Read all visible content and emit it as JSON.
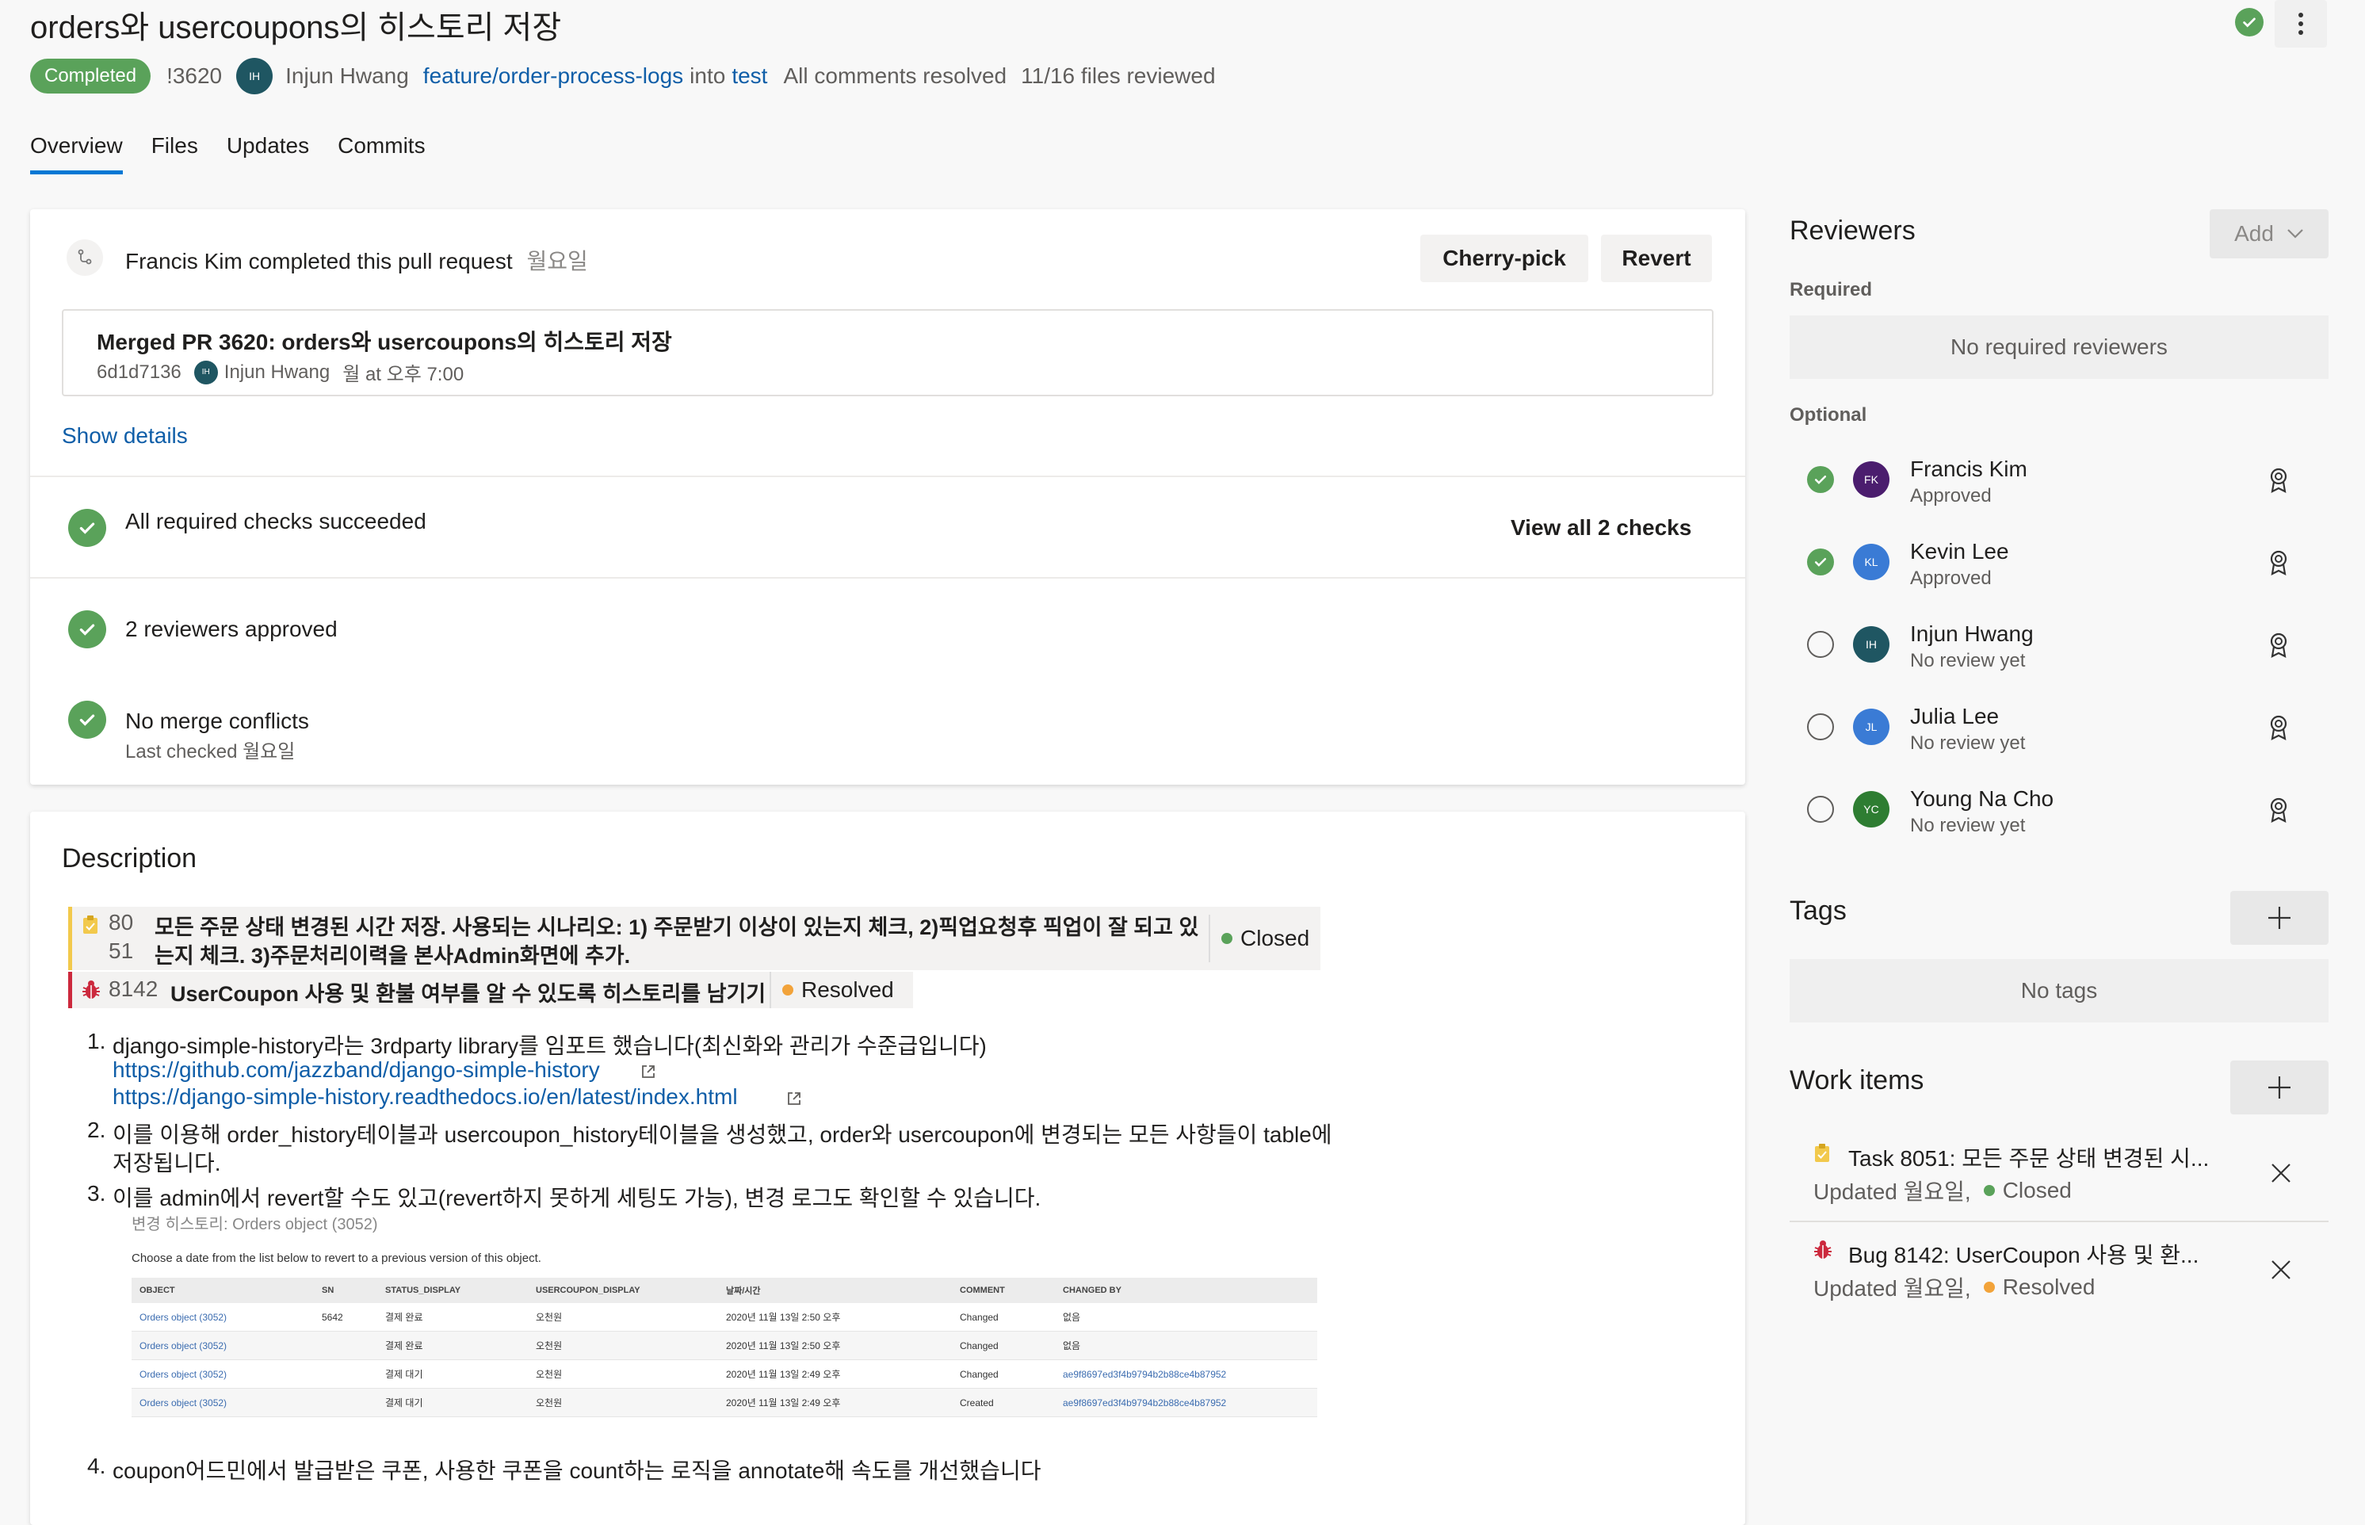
{
  "header": {
    "title": "orders와 usercoupons의 히스토리 저장",
    "status": "Completed",
    "pr_id": "!3620",
    "author_initials": "IH",
    "author": "Injun Hwang",
    "source_branch": "feature/order-process-logs",
    "into_label": "into",
    "target_branch": "test",
    "comments_status": "All comments resolved",
    "files_reviewed": "11/16 files reviewed"
  },
  "tabs": [
    "Overview",
    "Files",
    "Updates",
    "Commits"
  ],
  "completion": {
    "message": "Francis Kim completed this pull request",
    "when": "월요일",
    "cherry_pick": "Cherry-pick",
    "revert": "Revert",
    "merge_title": "Merged PR 3620: orders와 usercoupons의 히스토리 저장",
    "commit": "6d1d7136",
    "committer_initials": "IH",
    "committer": "Injun Hwang",
    "commit_time": "월 at 오후 7:00",
    "show_details": "Show details"
  },
  "checks": {
    "required_checks": "All required checks succeeded",
    "view_all": "View all 2 checks",
    "reviewers_approved": "2 reviewers approved",
    "merge_conflicts": "No merge conflicts",
    "last_checked": "Last checked 월요일"
  },
  "description": {
    "heading": "Description",
    "work_items": [
      {
        "num_a": "80",
        "num_b": "51",
        "text": "모든 주문 상태 변경된 시간 저장. 사용되는 시나리오: 1) 주문받기 이상이 있는지 체크, 2)픽업요청후 픽업이 잘 되고 있",
        "text2": "는지 체크. 3)주문처리이력을 본사Admin화면에 추가.",
        "state": "Closed",
        "state_color": "#5aa25a"
      },
      {
        "num_a": "8142",
        "text": "UserCoupon 사용 및 환불 여부를 알 수 있도록 히스토리를 남기기",
        "state": "Resolved",
        "state_color": "#f2a33a"
      }
    ],
    "items": [
      {
        "num": "1.",
        "text": "django-simple-history라는 3rdparty library를 임포트 했습니다(최신화와 관리가 수준급입니다)"
      },
      {
        "num": "2.",
        "text": "이를 이용해 order_history테이블과 usercoupon_history테이블을 생성했고, order와 usercoupon에 변경되는 모든 사항들이 table에",
        "text2": "저장됩니다."
      },
      {
        "num": "3.",
        "text": "이를 admin에서 revert할 수도 있고(revert하지 못하게 세팅도 가능), 변경 로그도 확인할 수 있습니다."
      },
      {
        "num": "4.",
        "text": "coupon어드민에서 발급받은 쿠폰, 사용한 쿠폰을 count하는 로직을 annotate해 속도를 개선했습니다"
      }
    ],
    "links": [
      "https://github.com/jazzband/django-simple-history",
      "https://django-simple-history.readthedocs.io/en/latest/index.html"
    ],
    "screenshot": {
      "caption": "변경 히스토리: Orders object (3052)",
      "instruction": "Choose a date from the list below to revert to a previous version of this object.",
      "columns": [
        "OBJECT",
        "SN",
        "STATUS_DISPLAY",
        "USERCOUPON_DISPLAY",
        "날짜/시간",
        "COMMENT",
        "CHANGED BY"
      ],
      "rows": [
        [
          "Orders object (3052)",
          "5642",
          "결제 완료",
          "오천원",
          "2020년 11월 13일 2:50 오후",
          "Changed",
          "없음"
        ],
        [
          "Orders object (3052)",
          "",
          "결제 완료",
          "오천원",
          "2020년 11월 13일 2:50 오후",
          "Changed",
          "없음"
        ],
        [
          "Orders object (3052)",
          "",
          "결제 대기",
          "오천원",
          "2020년 11월 13일 2:49 오후",
          "Changed",
          "ae9f8697ed3f4b9794b2b88ce4b87952"
        ],
        [
          "Orders object (3052)",
          "",
          "결제 대기",
          "오천원",
          "2020년 11월 13일 2:49 오후",
          "Created",
          "ae9f8697ed3f4b9794b2b88ce4b87952"
        ]
      ]
    }
  },
  "reviewers": {
    "heading": "Reviewers",
    "add": "Add",
    "required_label": "Required",
    "no_required": "No required reviewers",
    "optional_label": "Optional",
    "list": [
      {
        "initials": "FK",
        "name": "Francis Kim",
        "status": "Approved",
        "color": "#4b1d6e",
        "approved": true
      },
      {
        "initials": "KL",
        "name": "Kevin Lee",
        "status": "Approved",
        "color": "#3a7bd5",
        "approved": true
      },
      {
        "initials": "IH",
        "name": "Injun Hwang",
        "status": "No review yet",
        "color": "#1f5662",
        "approved": false
      },
      {
        "initials": "JL",
        "name": "Julia Lee",
        "status": "No review yet",
        "color": "#3a7bd5",
        "approved": false
      },
      {
        "initials": "YC",
        "name": "Young Na Cho",
        "status": "No review yet",
        "color": "#2e7d32",
        "approved": false
      }
    ]
  },
  "tags": {
    "heading": "Tags",
    "empty": "No tags"
  },
  "work_items": {
    "heading": "Work items",
    "list": [
      {
        "type": "Task",
        "title": "Task 8051: 모든 주문 상태 변경된 시...",
        "updated": "Updated 월요일,",
        "state": "Closed",
        "state_color": "#5aa25a"
      },
      {
        "type": "Bug",
        "title": "Bug 8142: UserCoupon 사용 및 환...",
        "updated": "Updated 월요일,",
        "state": "Resolved",
        "state_color": "#f2a33a"
      }
    ]
  }
}
